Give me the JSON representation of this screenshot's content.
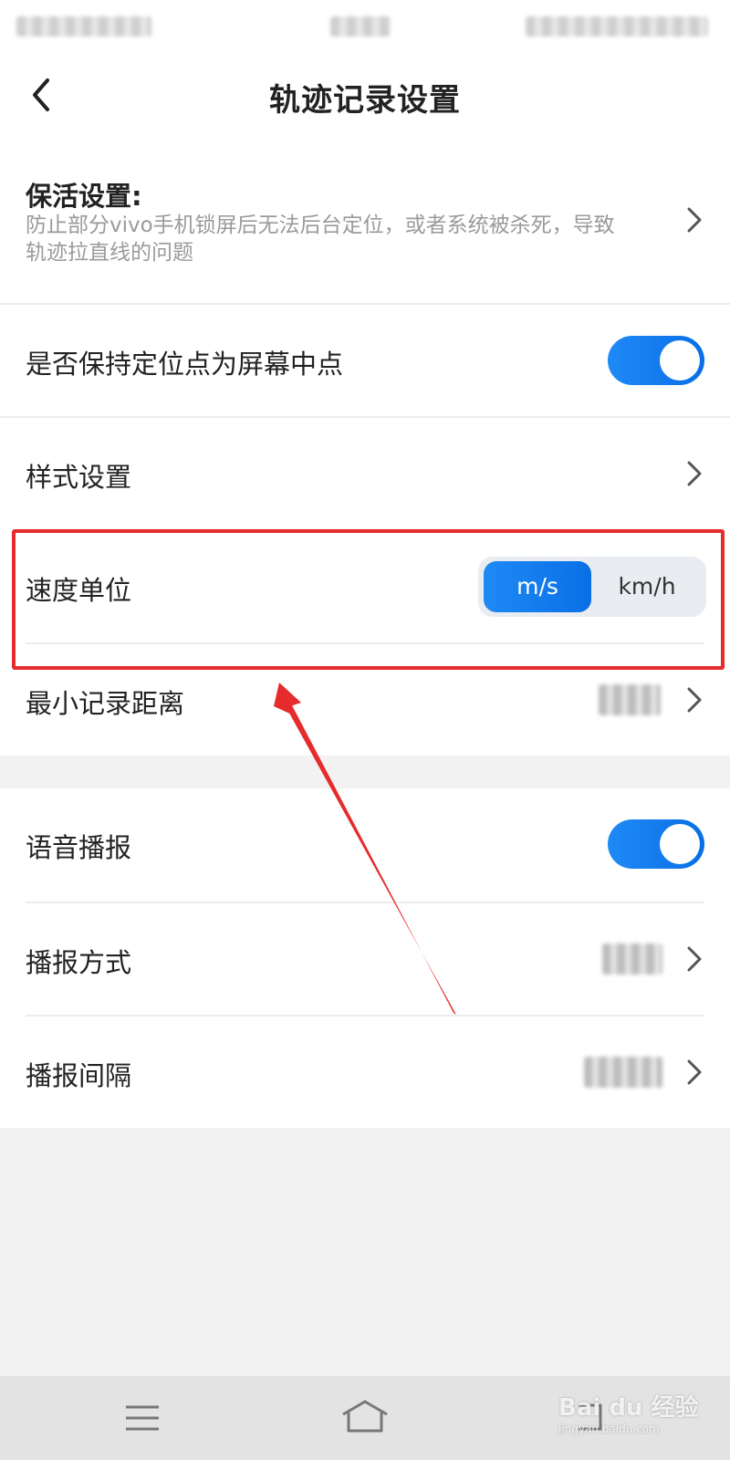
{
  "header": {
    "title": "轨迹记录设置"
  },
  "settings": {
    "keep_alive": {
      "label": "保活设置:",
      "description": "防止部分vivo手机锁屏后无法后台定位，或者系统被杀死，导致轨迹拉直线的问题"
    },
    "keep_center": {
      "label": "是否保持定位点为屏幕中点",
      "enabled": true
    },
    "style": {
      "label": "样式设置"
    },
    "speed_unit": {
      "label": "速度单位",
      "options": [
        "m/s",
        "km/h"
      ],
      "selected": "m/s"
    },
    "min_distance": {
      "label": "最小记录距离"
    },
    "voice": {
      "label": "语音播报",
      "enabled": true
    },
    "broadcast_mode": {
      "label": "播报方式"
    },
    "broadcast_interval": {
      "label": "播报间隔"
    }
  },
  "nav": {
    "icons": [
      "menu-icon",
      "home-icon",
      "back-icon"
    ]
  },
  "watermark": {
    "text": "Bai du 经验",
    "sub": "jingyan.baidu.com"
  },
  "colors": {
    "accent": "#0a6fe6",
    "highlight": "#e52b2b"
  }
}
